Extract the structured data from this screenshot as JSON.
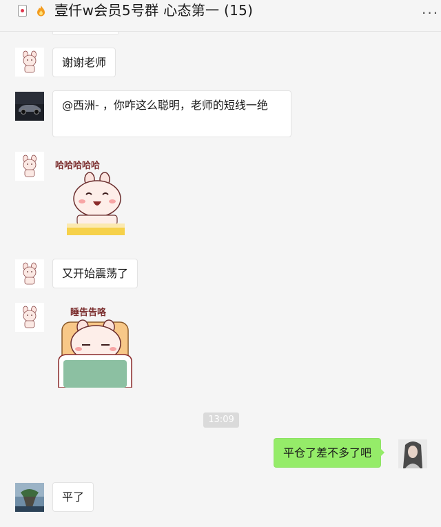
{
  "header": {
    "title": "壹仟w会员5号群 心态第一 (15)",
    "more_label": "···"
  },
  "messages": [
    {
      "sender": "other",
      "text": "谢谢老师",
      "avatar_icon": "bunny-avatar-icon"
    },
    {
      "sender": "other",
      "text": "@西洲- ，你咋这么聪明，老师的短线一绝",
      "avatar_icon": "car-avatar-icon"
    },
    {
      "sender": "other",
      "type": "sticker",
      "sticker_text": "哈哈哈哈哈",
      "sticker_icon": "laughing-bunny-sticker",
      "avatar_icon": "bunny-avatar-icon"
    },
    {
      "sender": "other",
      "text": "又开始震荡了",
      "avatar_icon": "bunny-avatar-icon"
    },
    {
      "sender": "other",
      "type": "sticker",
      "sticker_text": "睡告告咯",
      "sticker_icon": "sleeping-bunny-sticker",
      "avatar_icon": "bunny-avatar-icon"
    },
    {
      "sender": "me",
      "text": "平仓了差不多了吧",
      "avatar_icon": "woman-avatar-icon"
    },
    {
      "sender": "other",
      "text": "平了",
      "avatar_icon": "island-avatar-icon"
    }
  ],
  "timestamp": "13:09",
  "colors": {
    "my_bubble": "#95ec69",
    "background": "#f5f5f5",
    "time_badge": "#dadada"
  }
}
